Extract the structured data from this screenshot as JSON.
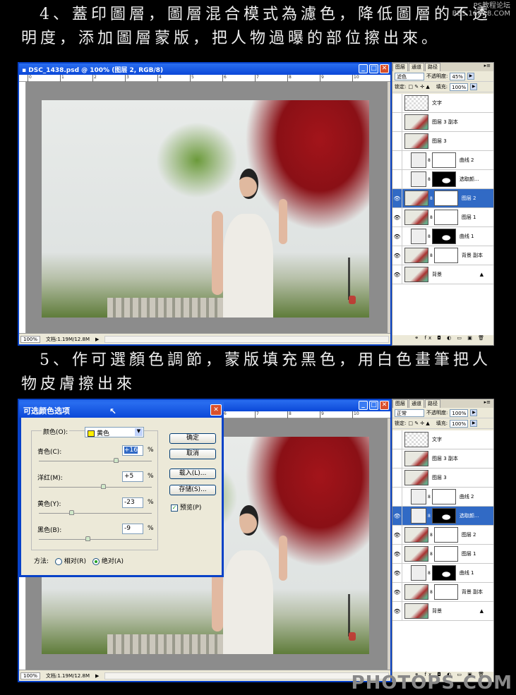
{
  "step4": {
    "line1": "4、蓋印圖層，圖層混合模式為濾色，降低圖層的不透",
    "line2": "明度，添加圖層蒙版，把人物過曝的部位擦出來。"
  },
  "step5": {
    "line1": "5、作可選顏色調節，蒙版填充黑色，用白色畫筆把人",
    "line2": "物皮膚擦出來"
  },
  "watermark_top": {
    "line1": "PS教程论坛",
    "line2": "BBS.16XX8.COM"
  },
  "watermark_bottom": "PHOTOPS.COM",
  "window": {
    "title": "DSC_1438.psd @ 100% (图层 2, RGB/8)",
    "ruler_ticks": [
      "0",
      "1",
      "2",
      "3",
      "4",
      "5",
      "6",
      "7",
      "8",
      "9",
      "10"
    ],
    "zoom": "100%",
    "doc_size": "文档:1.19M/12.8M"
  },
  "panel_top": {
    "tabs": [
      "图层",
      "通道",
      "路径"
    ],
    "blend_mode": "滤色",
    "opacity_label": "不透明度:",
    "opacity": "45%",
    "lock_label": "锁定:",
    "fill_label": "填充:",
    "fill": "100%",
    "layers": [
      {
        "name": "文字",
        "thumb": "trans",
        "visible": false
      },
      {
        "name": "图层 3 副本",
        "thumb": "photo",
        "visible": false
      },
      {
        "name": "图层 3",
        "thumb": "photo",
        "visible": false
      },
      {
        "name": "曲线 2",
        "thumb": "adj",
        "mask": "white",
        "visible": false
      },
      {
        "name": "选取颜...",
        "thumb": "adj",
        "mask": "black",
        "visible": false
      },
      {
        "name": "图层 2",
        "thumb": "photo",
        "mask": "white",
        "visible": true,
        "active": true
      },
      {
        "name": "图层 1",
        "thumb": "photo",
        "mask": "white",
        "visible": true
      },
      {
        "name": "曲线 1",
        "thumb": "adj",
        "mask": "black",
        "visible": true
      },
      {
        "name": "背景 副本",
        "thumb": "photo",
        "mask": "white",
        "visible": true
      },
      {
        "name": "背景",
        "thumb": "photo",
        "visible": true,
        "locked": true
      }
    ]
  },
  "panel_bottom": {
    "tabs": [
      "图层",
      "通道",
      "路径"
    ],
    "blend_mode": "正常",
    "opacity_label": "不透明度:",
    "opacity": "100%",
    "lock_label": "锁定:",
    "fill_label": "填充:",
    "fill": "100%",
    "layers": [
      {
        "name": "文字",
        "thumb": "trans",
        "visible": false
      },
      {
        "name": "图层 3 副本",
        "thumb": "photo",
        "visible": false
      },
      {
        "name": "图层 3",
        "thumb": "photo",
        "visible": false
      },
      {
        "name": "曲线 2",
        "thumb": "adj",
        "mask": "white",
        "visible": false
      },
      {
        "name": "选取颜...",
        "thumb": "adj",
        "mask": "black",
        "visible": true,
        "active": true
      },
      {
        "name": "图层 2",
        "thumb": "photo",
        "mask": "white",
        "visible": true
      },
      {
        "name": "图层 1",
        "thumb": "photo",
        "mask": "white",
        "visible": true
      },
      {
        "name": "曲线 1",
        "thumb": "adj",
        "mask": "black",
        "visible": true
      },
      {
        "name": "背景 副本",
        "thumb": "photo",
        "mask": "white",
        "visible": true
      },
      {
        "name": "背景",
        "thumb": "photo",
        "visible": true,
        "locked": true
      }
    ]
  },
  "dialog": {
    "title": "可选颜色选项",
    "colors_label": "颜色(O):",
    "colors_value": "黄色",
    "sliders": [
      {
        "label": "青色(C):",
        "value": "+16",
        "level": 16
      },
      {
        "label": "洋红(M):",
        "value": "+5",
        "level": 5
      },
      {
        "label": "黄色(Y):",
        "value": "-23",
        "level": -23
      },
      {
        "label": "黑色(B):",
        "value": "-9",
        "level": -9
      }
    ],
    "pct": "%",
    "ok": "确定",
    "cancel": "取消",
    "load": "载入(L)...",
    "save": "存储(S)...",
    "preview": "预览(P)",
    "preview_checked": true,
    "method_label": "方法:",
    "relative": "相对(R)",
    "absolute": "绝对(A)",
    "method_selected": "absolute"
  }
}
